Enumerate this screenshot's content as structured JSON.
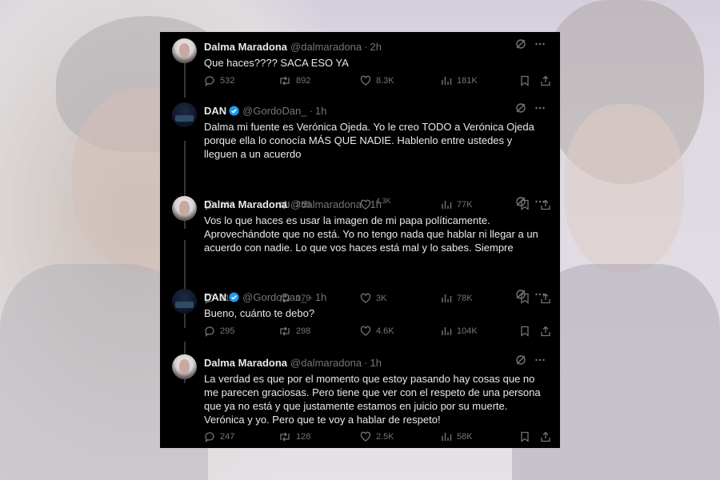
{
  "tweets": [
    {
      "name": "Dalma Maradona",
      "handle": "@dalmaradona",
      "time": "2h",
      "verified": false,
      "text": "Que haces???? SACA ESO YA",
      "replies": "532",
      "retweets": "892",
      "likes": "8.3K",
      "views": "181K"
    },
    {
      "name": "DAN",
      "handle": "@GordoDan_",
      "time": "1h",
      "verified": true,
      "text": "Dalma mi fuente es Verónica Ojeda. Yo le creo TODO a Verónica Ojeda porque ella lo conocía MÁS QUE NADIE. Hablenlo entre ustedes y lleguen a un acuerdo",
      "replies": "184",
      "retweets": "255",
      "likes": "4.3K",
      "views": "77K"
    },
    {
      "name": "Dalma Maradona",
      "handle": "@dalmaradona",
      "time": "1h",
      "verified": false,
      "text": "Vos lo que haces es usar la imagen de mi papa políticamente. Aprovechándote que no está. Yo no tengo nada que hablar ni llegar a un acuerdo con nadie. Lo que vos haces está mal y lo sabes. Siempre",
      "replies": "211",
      "retweets": "179",
      "likes": "3K",
      "views": "78K"
    },
    {
      "name": "DAN",
      "handle": "@GordoDan_",
      "time": "1h",
      "verified": true,
      "text": "Bueno, cuánto te debo?",
      "replies": "295",
      "retweets": "298",
      "likes": "4.6K",
      "views": "104K"
    },
    {
      "name": "Dalma Maradona",
      "handle": "@dalmaradona",
      "time": "1h",
      "verified": false,
      "text": "La verdad es que por el momento que estoy pasando hay cosas que no me parecen graciosas. Pero tiene que ver con el respeto de una persona que ya no está y que justamente estamos en juicio por su muerte. Verónica y yo. Pero  que te voy a hablar de respeto!",
      "replies": "247",
      "retweets": "128",
      "likes": "2.5K",
      "views": "58K"
    }
  ],
  "colors": {
    "panel_bg": "#000000",
    "text": "#e7e9ea",
    "muted": "#71767b",
    "verified": "#1d9bf0"
  },
  "icons": [
    "grok-icon",
    "more-icon",
    "reply-icon",
    "retweet-icon",
    "like-icon",
    "views-icon",
    "bookmark-icon",
    "share-icon",
    "verified-badge-icon"
  ]
}
